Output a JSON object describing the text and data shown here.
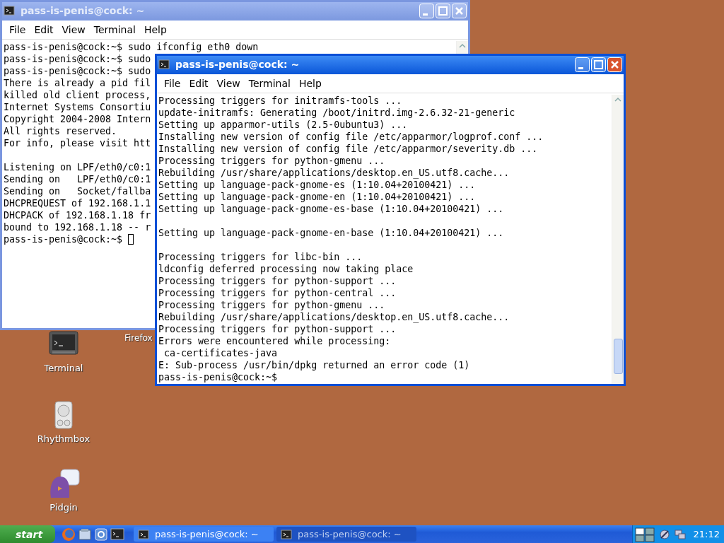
{
  "windows": [
    {
      "title": "pass-is-penis@cock: ~",
      "active": false,
      "cursor": true,
      "menu": [
        "File",
        "Edit",
        "View",
        "Terminal",
        "Help"
      ],
      "blocks": [
        [
          "pass-is-penis@cock:~$ sudo ifconfig eth0 down",
          "pass-is-penis@cock:~$ sudo",
          "pass-is-penis@cock:~$ sudo",
          "There is already a pid fil",
          "killed old client process,",
          "Internet Systems Consortiu",
          "Copyright 2004-2008 Intern",
          "All rights reserved.",
          "For info, please visit htt"
        ],
        [
          "Listening on LPF/eth0/c0:1",
          "Sending on   LPF/eth0/c0:1",
          "Sending on   Socket/fallba",
          "DHCPREQUEST of 192.168.1.1",
          "DHCPACK of 192.168.1.18 fr",
          "bound to 192.168.1.18 -- r",
          "pass-is-penis@cock:~$ "
        ]
      ]
    },
    {
      "title": "pass-is-penis@cock: ~",
      "active": true,
      "cursor": false,
      "menu": [
        "File",
        "Edit",
        "View",
        "Terminal",
        "Help"
      ],
      "blocks": [
        [
          "Processing triggers for initramfs-tools ...",
          "update-initramfs: Generating /boot/initrd.img-2.6.32-21-generic",
          "Setting up apparmor-utils (2.5-0ubuntu3) ...",
          "Installing new version of config file /etc/apparmor/logprof.conf ...",
          "Installing new version of config file /etc/apparmor/severity.db ...",
          "Processing triggers for python-gmenu ...",
          "Rebuilding /usr/share/applications/desktop.en_US.utf8.cache...",
          "Setting up language-pack-gnome-es (1:10.04+20100421) ...",
          "Setting up language-pack-gnome-en (1:10.04+20100421) ...",
          "Setting up language-pack-gnome-es-base (1:10.04+20100421) ..."
        ],
        [
          "Setting up language-pack-gnome-en-base (1:10.04+20100421) ..."
        ],
        [
          "Processing triggers for libc-bin ...",
          "ldconfig deferred processing now taking place",
          "Processing triggers for python-support ...",
          "Processing triggers for python-central ...",
          "Processing triggers for python-gmenu ...",
          "Rebuilding /usr/share/applications/desktop.en_US.utf8.cache...",
          "Processing triggers for python-support ...",
          "Errors were encountered while processing:",
          " ca-certificates-java",
          "E: Sub-process /usr/bin/dpkg returned an error code (1)",
          "pass-is-penis@cock:~$"
        ]
      ]
    }
  ],
  "desktop_icons": [
    {
      "label": "Firefox",
      "kind": "covered"
    },
    {
      "label": "Terminal",
      "kind": "terminal"
    },
    {
      "label": "Rhythmbox",
      "kind": "player"
    },
    {
      "label": "Pidgin",
      "kind": "chat"
    }
  ],
  "taskbar": {
    "start": "start",
    "tasks": [
      {
        "label": "pass-is-penis@cock: ~",
        "selected": false
      },
      {
        "label": "pass-is-penis@cock: ~",
        "selected": true
      }
    ],
    "clock": "21:12"
  }
}
